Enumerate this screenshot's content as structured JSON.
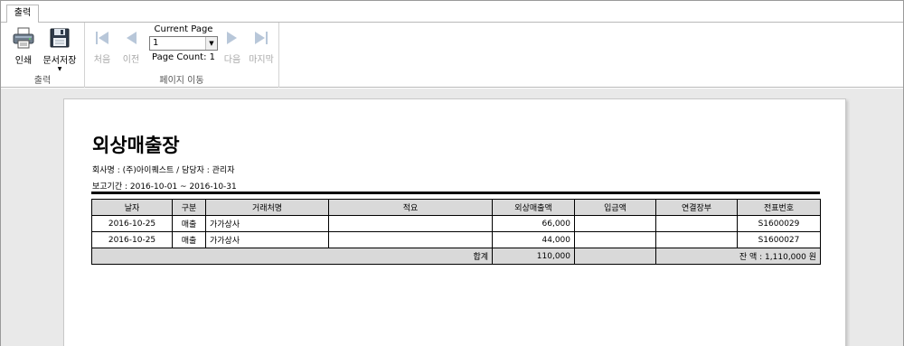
{
  "ribbon": {
    "tab_label": "출력",
    "groups": {
      "output": {
        "label": "출력",
        "print_label": "인쇄",
        "save_doc_label": "문서저장"
      },
      "page_nav": {
        "label": "페이지 이동",
        "first_label": "처음",
        "prev_label": "이전",
        "next_label": "다음",
        "last_label": "마지막",
        "current_page_caption": "Current Page",
        "current_page_value": "1",
        "page_count_text": "Page Count: 1"
      }
    }
  },
  "report": {
    "title": "외상매출장",
    "company_line": "회사명 : (주)아이퀘스트 / 담당자 : 관리자",
    "period_line": "보고기간 :  2016-10-01 ~ 2016-10-31",
    "columns": [
      "날자",
      "구분",
      "거래처명",
      "적요",
      "외상매출액",
      "입금액",
      "연결장부",
      "전표번호"
    ],
    "rows": [
      [
        "2016-10-25",
        "매출",
        "가가상사",
        "",
        "66,000",
        "",
        "",
        "S1600029"
      ],
      [
        "2016-10-25",
        "매출",
        "가가상사",
        "",
        "44,000",
        "",
        "",
        "S1600027"
      ]
    ],
    "total": {
      "label": "합계",
      "sales_amount": "110,000",
      "balance_text": "잔 액 : 1,110,000 원"
    }
  },
  "colors": {
    "header_fill": "#d9d9d9",
    "preview_background": "#e9e9e9",
    "disabled_text": "#a8a8a8"
  },
  "icons": [
    "printer-icon",
    "floppy-disk-icon",
    "first-page-icon",
    "previous-page-icon",
    "next-page-icon",
    "last-page-icon",
    "dropdown-arrow-icon"
  ]
}
